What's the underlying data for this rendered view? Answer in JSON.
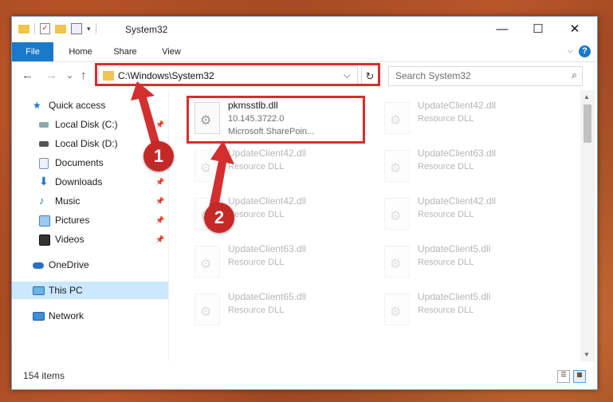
{
  "window": {
    "title": "System32"
  },
  "window_controls": {
    "minimize": "—",
    "maximize": "☐",
    "close": "✕"
  },
  "ribbon": {
    "tabs": [
      "File",
      "Home",
      "Share",
      "View"
    ],
    "help": "?"
  },
  "address": {
    "path": "C:\\Windows\\System32",
    "refresh": "↻",
    "dropdown": "⌵"
  },
  "search": {
    "placeholder": "Search System32",
    "icon": "⌕"
  },
  "nav": {
    "back": "←",
    "forward": "→",
    "recent": "⌄",
    "up": "↑"
  },
  "sidebar": {
    "items": [
      {
        "label": "Quick access",
        "icon": "star-icon",
        "pinned": false
      },
      {
        "label": "Local Disk (C:)",
        "icon": "drive-icon",
        "pinned": true
      },
      {
        "label": "Local Disk (D:)",
        "icon": "drive-icon",
        "pinned": false
      },
      {
        "label": "Documents",
        "icon": "documents-icon",
        "pinned": true
      },
      {
        "label": "Downloads",
        "icon": "download-icon",
        "pinned": true
      },
      {
        "label": "Music",
        "icon": "music-icon",
        "pinned": true
      },
      {
        "label": "Pictures",
        "icon": "pictures-icon",
        "pinned": true
      },
      {
        "label": "Videos",
        "icon": "videos-icon",
        "pinned": true
      },
      {
        "label": "OneDrive",
        "icon": "cloud-icon",
        "pinned": false
      },
      {
        "label": "This PC",
        "icon": "computer-icon",
        "pinned": false,
        "selected": true
      },
      {
        "label": "Network",
        "icon": "network-icon",
        "pinned": false
      }
    ]
  },
  "files": [
    {
      "name": "pkmsstlb.dll",
      "line2": "10.145.3722.0",
      "line3": "Microsoft SharePoin..."
    },
    {
      "name": "UpdateClient42.dll",
      "line2": "Resource DLL"
    },
    {
      "name": "UpdateClient42.dll",
      "line2": "Resource DLL"
    },
    {
      "name": "UpdateClient63.dll",
      "line2": "Resource DLL"
    },
    {
      "name": "UpdateClient42.dll",
      "line2": "Resource DLL"
    },
    {
      "name": "UpdateClient42.dll",
      "line2": "Resource DLL"
    },
    {
      "name": "UpdateClient63.dll",
      "line2": "Resource DLL"
    },
    {
      "name": "UpdateClient5.dll",
      "line2": "Resource DLL"
    },
    {
      "name": "UpdateClient65.dll",
      "line2": "Resource DLL"
    },
    {
      "name": "UpdateClient5.dll",
      "line2": "Resource DLL"
    }
  ],
  "status": {
    "item_count": "154 items"
  },
  "annotations": {
    "step1": "1",
    "step2": "2"
  },
  "colors": {
    "highlight": "#d32f2f",
    "accent": "#1979ca"
  }
}
